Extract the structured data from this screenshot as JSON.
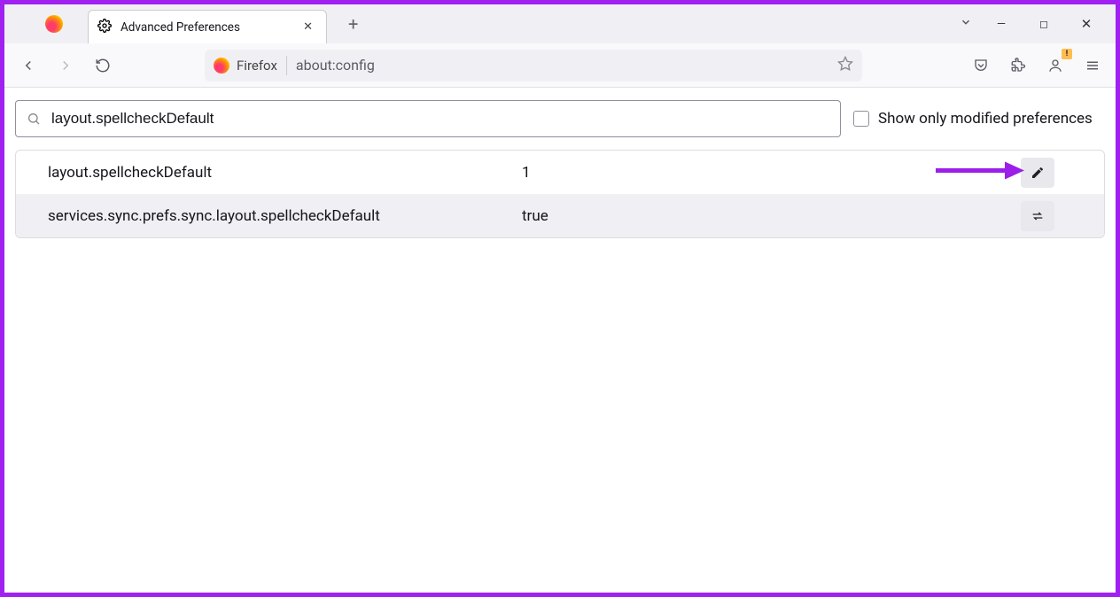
{
  "tab": {
    "title": "Advanced Preferences"
  },
  "urlbar": {
    "identity": "Firefox",
    "url": "about:config"
  },
  "search": {
    "value": "layout.spellcheckDefault"
  },
  "filter": {
    "checkbox_label": "Show only modified preferences",
    "checked": false
  },
  "prefs": [
    {
      "name": "layout.spellcheckDefault",
      "value": "1",
      "action": "edit"
    },
    {
      "name": "services.sync.prefs.sync.layout.spellcheckDefault",
      "value": "true",
      "action": "toggle"
    }
  ],
  "annotation": {
    "arrow_color": "#9b1fe8"
  }
}
